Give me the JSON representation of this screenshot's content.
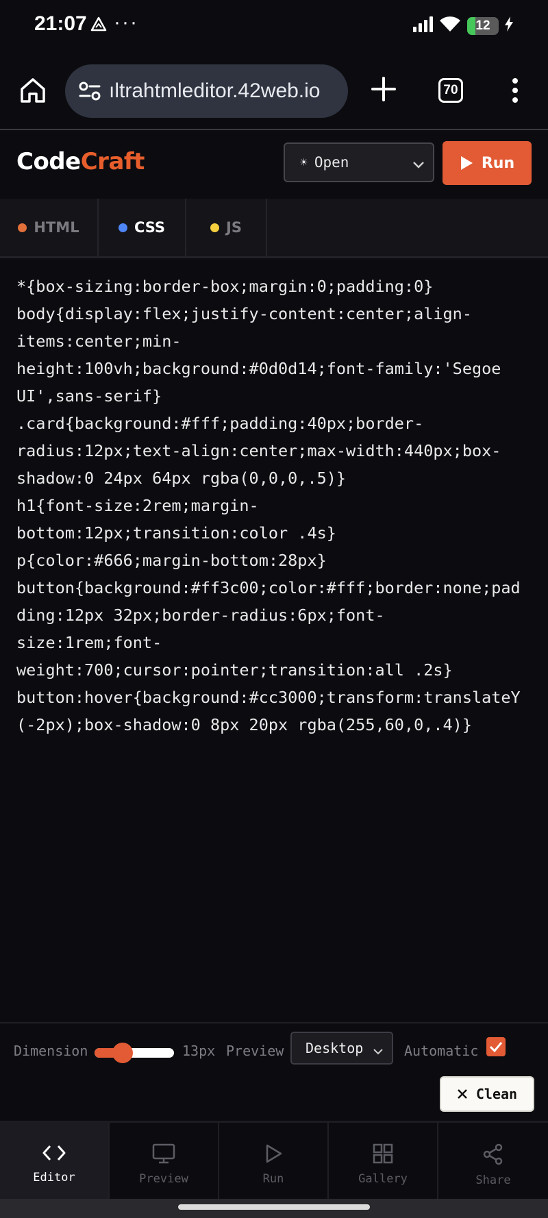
{
  "status_bar": {
    "time": "21:07",
    "more": "···",
    "battery_level": "12",
    "battery_fraction": 0.12
  },
  "browser": {
    "url": "ıltrahtmleditor.42web.io",
    "tab_count": "70"
  },
  "app": {
    "logo_part1": "Code",
    "logo_part2": "Craft",
    "open_select": {
      "value": "Open"
    },
    "run_label": "Run",
    "accent_color": "#e25b35"
  },
  "lang_tabs": [
    {
      "label": "HTML",
      "dot_color": "#e2703a",
      "active": false
    },
    {
      "label": "CSS",
      "dot_color": "#4f86f7",
      "active": true
    },
    {
      "label": "JS",
      "dot_color": "#f4d03f",
      "active": false
    }
  ],
  "code_lines": [
    "*{box-sizing:border-box;margin:0;padding:0}",
    "body{display:flex;justify-content:center;align-",
    "items:center;min-",
    "height:100vh;background:#0d0d14;font-family:'Segoe",
    "UI',sans-serif}",
    ".card{background:#fff;padding:40px;border-",
    "radius:12px;text-align:center;max-width:440px;box-",
    "shadow:0 24px 64px rgba(0,0,0,.5)}",
    "h1{font-size:2rem;margin-",
    "bottom:12px;transition:color .4s}",
    "p{color:#666;margin-bottom:28px}",
    "button{background:#ff3c00;color:#fff;border:none;pad",
    "ding:12px 32px;border-radius:6px;font-",
    "size:1rem;font-",
    "weight:700;cursor:pointer;transition:all .2s}",
    "button:hover{background:#cc3000;transform:translateY",
    "(-2px);box-shadow:0 8px 20px rgba(255,60,0,.4)}"
  ],
  "settings": {
    "dimension_label": "Dimension",
    "dimension_value": "13px",
    "dimension_slider_fraction": 0.35,
    "preview_label": "Preview",
    "device_value": "Desktop",
    "automatic_label": "Automatic",
    "automatic_checked": true
  },
  "clean_label": "Clean",
  "bottom_nav": [
    {
      "label": "Editor",
      "icon": "code-icon",
      "active": true
    },
    {
      "label": "Preview",
      "icon": "monitor-icon",
      "active": false
    },
    {
      "label": "Run",
      "icon": "play-icon",
      "active": false
    },
    {
      "label": "Gallery",
      "icon": "grid-icon",
      "active": false
    },
    {
      "label": "Share",
      "icon": "share-icon",
      "active": false
    }
  ]
}
